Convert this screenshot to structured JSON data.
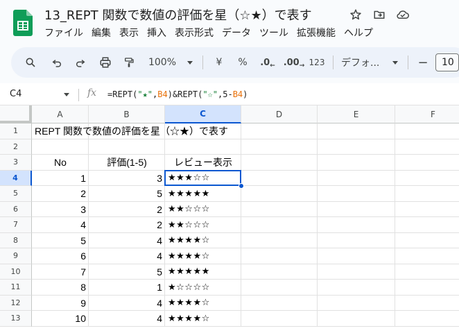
{
  "document": {
    "title": "13_REPT 関数で数値の評価を星（☆★）で表す"
  },
  "menu": [
    "ファイル",
    "編集",
    "表示",
    "挿入",
    "表示形式",
    "データ",
    "ツール",
    "拡張機能",
    "ヘルプ"
  ],
  "toolbar": {
    "zoom": "100%",
    "currency": "¥",
    "percent": "%",
    "decrease_decimal": ".0",
    "increase_decimal": ".00",
    "number_format": "123",
    "font": "デフォ...",
    "font_size": "10"
  },
  "formula_bar": {
    "cell_ref": "C4",
    "fx": "fx",
    "formula_parts": [
      {
        "text": "=REPT(",
        "kind": "plain"
      },
      {
        "text": "\"★\"",
        "kind": "string"
      },
      {
        "text": ",",
        "kind": "plain"
      },
      {
        "text": "B4",
        "kind": "ref"
      },
      {
        "text": ")&REPT(",
        "kind": "plain"
      },
      {
        "text": "\"☆\"",
        "kind": "string"
      },
      {
        "text": ",5-",
        "kind": "plain"
      },
      {
        "text": "B4",
        "kind": "ref"
      },
      {
        "text": ")",
        "kind": "plain"
      }
    ]
  },
  "sheet": {
    "columns": [
      "A",
      "B",
      "C",
      "D",
      "E",
      "F"
    ],
    "row_numbers": [
      "1",
      "2",
      "3",
      "4",
      "5",
      "6",
      "7",
      "8",
      "9",
      "10",
      "11",
      "12",
      "13"
    ],
    "title_cell": "REPT 関数で数値の評価を星（☆★）で表す",
    "headers": {
      "no": "No",
      "rating": "評価(1-5)",
      "review": "レビュー表示"
    },
    "rows": [
      {
        "no": "1",
        "rating": "3",
        "review": "★★★☆☆"
      },
      {
        "no": "2",
        "rating": "5",
        "review": "★★★★★"
      },
      {
        "no": "3",
        "rating": "2",
        "review": "★★☆☆☆"
      },
      {
        "no": "4",
        "rating": "2",
        "review": "★★☆☆☆"
      },
      {
        "no": "5",
        "rating": "4",
        "review": "★★★★☆"
      },
      {
        "no": "6",
        "rating": "4",
        "review": "★★★★☆"
      },
      {
        "no": "7",
        "rating": "5",
        "review": "★★★★★"
      },
      {
        "no": "8",
        "rating": "1",
        "review": "★☆☆☆☆"
      },
      {
        "no": "9",
        "rating": "4",
        "review": "★★★★☆"
      },
      {
        "no": "10",
        "rating": "4",
        "review": "★★★★☆"
      }
    ],
    "active_cell": "C4"
  },
  "colors": {
    "accent": "#0b57d0",
    "logo_green": "#0f9d58",
    "formula_string": "#188038",
    "formula_ref": "#e8710a"
  }
}
